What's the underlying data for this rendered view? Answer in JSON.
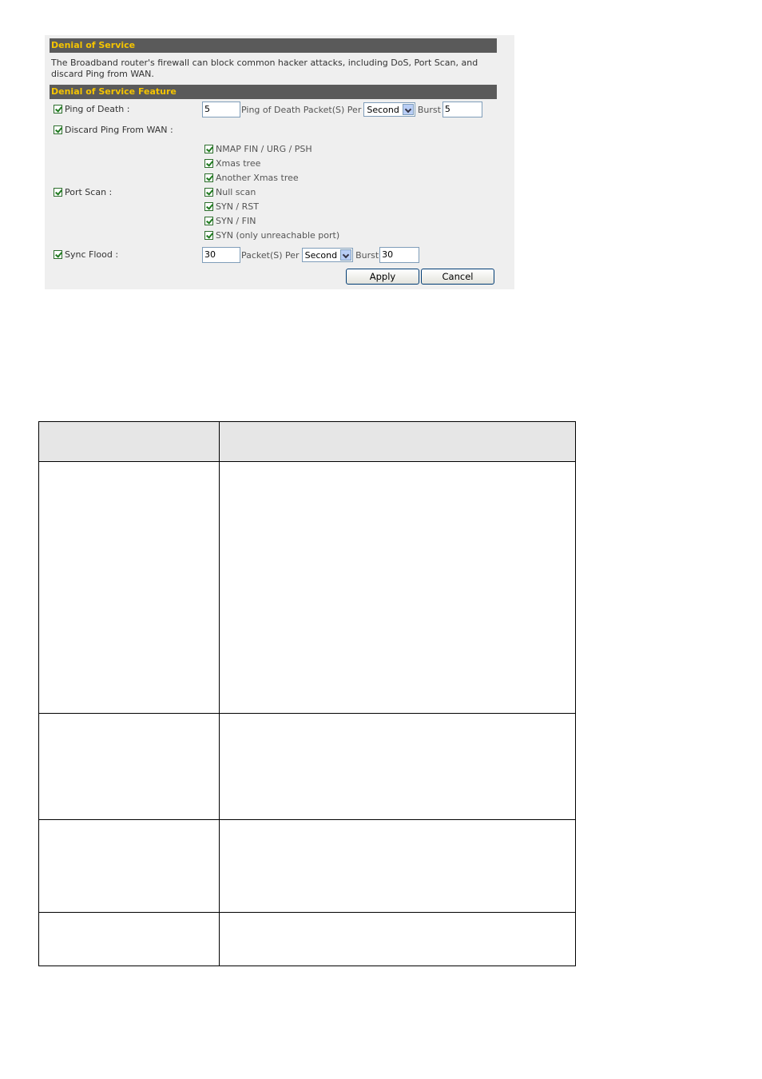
{
  "panel": {
    "header": "Denial of Service",
    "description": "The Broadband router's firewall can block common hacker attacks, including DoS, Port Scan, and discard Ping from WAN.",
    "feature_header": "Denial of Service Feature",
    "ping_of_death": {
      "label": "Ping of Death :",
      "packets_value": "5",
      "unit_text": "Ping of Death Packet(S) Per",
      "per_value": "Second",
      "burst_label": "Burst",
      "burst_value": "5"
    },
    "discard_ping": {
      "label": "Discard Ping From WAN :"
    },
    "port_scan": {
      "label": "Port Scan :",
      "options": [
        "NMAP FIN / URG / PSH",
        "Xmas tree",
        "Another Xmas tree",
        "Null scan",
        "SYN / RST",
        "SYN / FIN",
        "SYN (only unreachable port)"
      ]
    },
    "sync_flood": {
      "label": "Sync Flood :",
      "packets_value": "30",
      "unit_text": "Packet(S) Per",
      "per_value": "Second",
      "burst_label": "Burst",
      "burst_value": "30"
    },
    "apply_label": "Apply",
    "cancel_label": "Cancel"
  },
  "colors": {
    "bar_bg": "#5a5a5a",
    "bar_text": "#f5c400",
    "panel_bg": "#efefef",
    "table_header_bg": "#e6e6e6"
  }
}
